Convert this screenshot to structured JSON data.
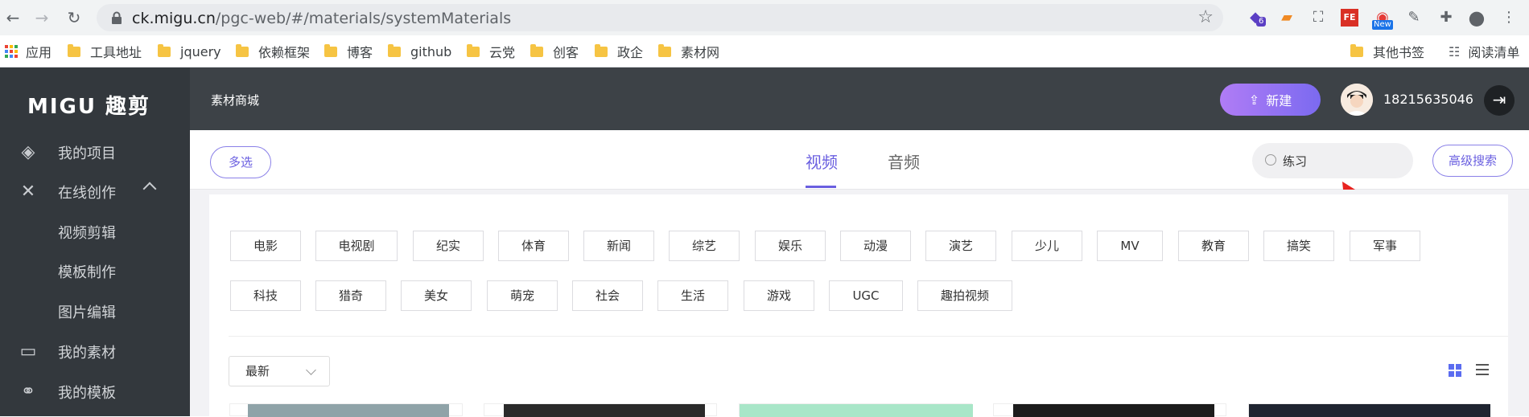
{
  "browser": {
    "url_host": "ck.migu.cn",
    "url_path": "/pgc-web/#/materials/systemMaterials",
    "extensions": [
      {
        "name": "extension-badge-icon",
        "badge": "6"
      },
      {
        "name": "extension-new-icon",
        "badge": "New"
      }
    ]
  },
  "bookmarks": {
    "apps": "应用",
    "items": [
      "工具地址",
      "jquery",
      "依赖框架",
      "博客",
      "github",
      "云党",
      "创客",
      "政企",
      "素材网"
    ],
    "other": "其他书签",
    "reading_list": "阅读清单"
  },
  "sidebar": {
    "logo": "MIGU 趣剪",
    "items": [
      {
        "label": "我的项目"
      },
      {
        "label": "在线创作"
      },
      {
        "label": "视频剪辑"
      },
      {
        "label": "模板制作"
      },
      {
        "label": "图片编辑"
      },
      {
        "label": "我的素材"
      },
      {
        "label": "我的模板"
      }
    ]
  },
  "header": {
    "title": "素材商城",
    "new_button": "新建",
    "phone": "18215635046"
  },
  "toolbar": {
    "multi_select": "多选",
    "tabs": [
      {
        "label": "视频"
      },
      {
        "label": "音频"
      }
    ],
    "active_tab": "视频",
    "search_value": "练习",
    "advanced_search": "高级搜索"
  },
  "categories": {
    "row1": [
      "电影",
      "电视剧",
      "纪实",
      "体育",
      "新闻",
      "综艺",
      "娱乐",
      "动漫",
      "演艺",
      "少儿",
      "MV",
      "教育",
      "搞笑",
      "军事"
    ],
    "row2": [
      "科技",
      "猎奇",
      "美女",
      "萌宠",
      "社会",
      "生活",
      "游戏",
      "UGC",
      "趣拍视频"
    ]
  },
  "sort": {
    "selected": "最新"
  },
  "colors": {
    "accent": "#6a5fe0",
    "sidebar": "#33383d",
    "header": "#3d4247"
  }
}
